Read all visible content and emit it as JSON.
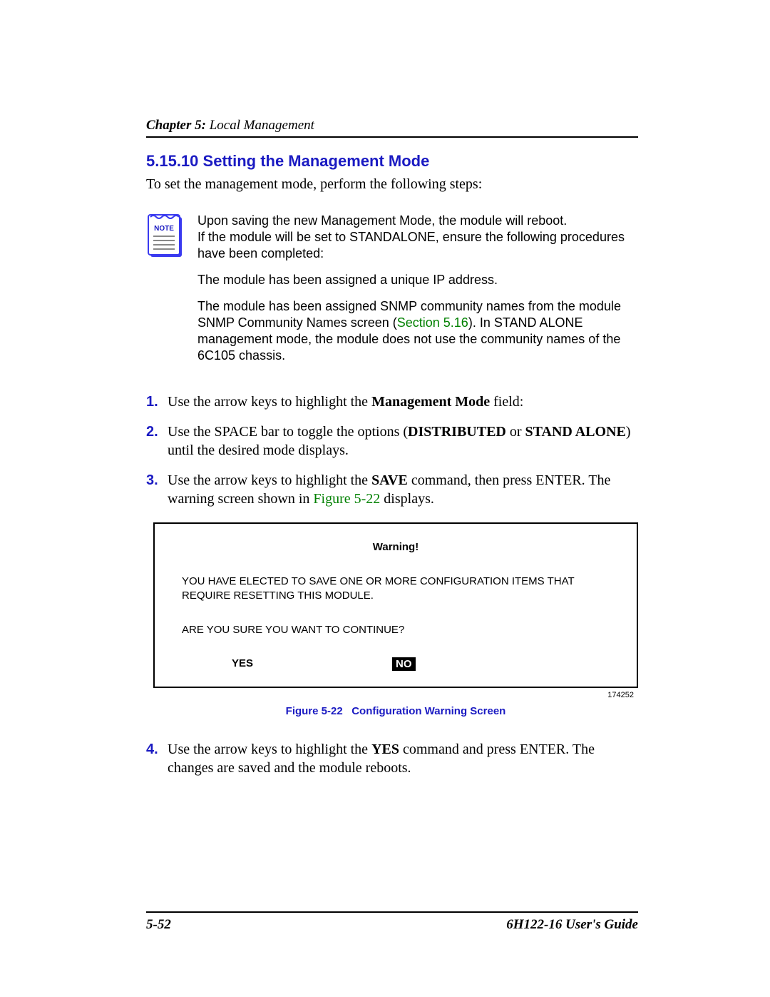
{
  "header": {
    "chapter_prefix": "Chapter 5:",
    "chapter_title": " Local Management"
  },
  "section": {
    "number": "5.15.10",
    "title": "Setting the Management Mode"
  },
  "intro": "To set the management mode, perform the following steps:",
  "note": {
    "label": "NOTE",
    "p1": "Upon saving the new Management Mode, the module will reboot.",
    "p2": "If the module will be set to STANDALONE, ensure the following procedures have been completed:",
    "p3": "The module has been assigned a unique IP address.",
    "p4a": "The module has been assigned SNMP community names from the module SNMP Community Names screen (",
    "p4_link": "Section 5.16",
    "p4b": "). In STAND ALONE management mode, the module does not use the community names of the 6C105 chassis."
  },
  "steps": [
    {
      "num": "1.",
      "pre": "Use the arrow keys to highlight the ",
      "bold": "Management Mode",
      "post": " field:"
    },
    {
      "num": "2.",
      "pre": "Use the SPACE bar to toggle the options (",
      "bold": "DISTRIBUTED",
      "mid": " or ",
      "bold2": "STAND ALONE",
      "post": ") until the desired mode displays."
    },
    {
      "num": "3.",
      "pre": "Use the arrow keys to highlight the ",
      "bold": "SAVE",
      "mid": " command, then press ENTER. The warning screen shown in ",
      "link": "Figure 5-22",
      "post": " displays."
    }
  ],
  "figure": {
    "warning_title": "Warning!",
    "message": "YOU HAVE ELECTED TO SAVE ONE OR MORE CONFIGURATION ITEMS THAT REQUIRE RESETTING THIS MODULE.",
    "question": "ARE YOU SURE YOU WANT TO CONTINUE?",
    "yes": "YES",
    "no": "NO",
    "ref_id": "174252",
    "caption_label": "Figure 5-22",
    "caption_text": "Configuration Warning Screen"
  },
  "step4": {
    "num": "4.",
    "pre": "Use the arrow keys to highlight the ",
    "bold": "YES",
    "post": " command and press ENTER. The changes are saved and the module reboots."
  },
  "footer": {
    "page": "5-52",
    "guide": "6H122-16 User's Guide"
  }
}
